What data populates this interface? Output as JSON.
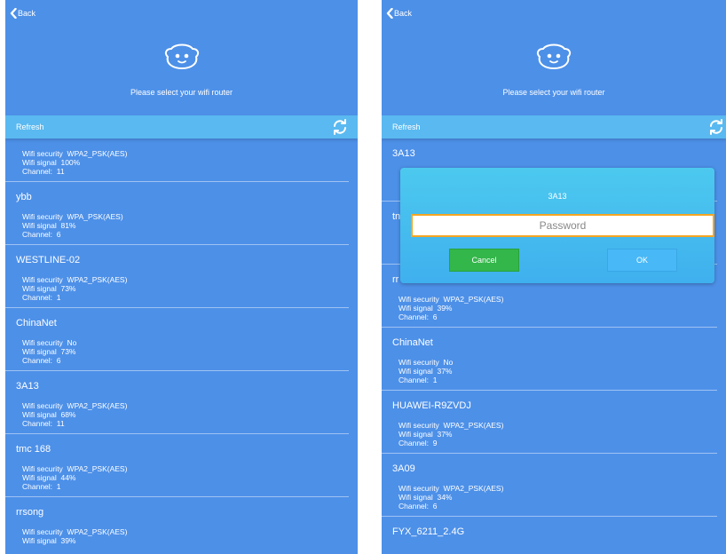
{
  "left": {
    "back_label": "Back",
    "subtitle": "Please select your wifi router",
    "refresh_label": "Refresh",
    "items": [
      {
        "name": "",
        "security_label": "Wifi security",
        "security": "WPA2_PSK(AES)",
        "signal_label": "Wifi signal",
        "signal": "100%",
        "channel_label": "Channel:",
        "channel": "11"
      },
      {
        "name": "ybb",
        "security_label": "Wifi security",
        "security": "WPA_PSK(AES)",
        "signal_label": "Wifi signal",
        "signal": "81%",
        "channel_label": "Channel:",
        "channel": "6"
      },
      {
        "name": "WESTLINE-02",
        "security_label": "Wifi security",
        "security": "WPA2_PSK(AES)",
        "signal_label": "Wifi signal",
        "signal": "73%",
        "channel_label": "Channel:",
        "channel": "1"
      },
      {
        "name": "ChinaNet",
        "security_label": "Wifi security",
        "security": "No",
        "signal_label": "Wifi signal",
        "signal": "73%",
        "channel_label": "Channel:",
        "channel": "6"
      },
      {
        "name": "3A13",
        "security_label": "Wifi security",
        "security": "WPA2_PSK(AES)",
        "signal_label": "Wifi signal",
        "signal": "68%",
        "channel_label": "Channel:",
        "channel": "11"
      },
      {
        "name": "tmc 168",
        "security_label": "Wifi security",
        "security": "WPA2_PSK(AES)",
        "signal_label": "Wifi signal",
        "signal": "44%",
        "channel_label": "Channel:",
        "channel": "1"
      },
      {
        "name": "rrsong",
        "security_label": "Wifi security",
        "security": "WPA2_PSK(AES)",
        "signal_label": "Wifi signal",
        "signal": "39%",
        "channel_label": "",
        "channel": ""
      }
    ]
  },
  "right": {
    "back_label": "Back",
    "subtitle": "Please select your wifi router",
    "refresh_label": "Refresh",
    "items": [
      {
        "name": "3A13",
        "security_label": "",
        "security": "",
        "signal_label": "",
        "signal": "",
        "channel_label": "",
        "channel": ""
      },
      {
        "name": "tn",
        "security_label": "",
        "security": "",
        "signal_label": "",
        "signal": "",
        "channel_label": "",
        "channel": ""
      },
      {
        "name": "rr",
        "security_label": "Wifi security",
        "security": "WPA2_PSK(AES)",
        "signal_label": "Wifi signal",
        "signal": "39%",
        "channel_label": "Channel:",
        "channel": "6"
      },
      {
        "name": "ChinaNet",
        "security_label": "Wifi security",
        "security": "No",
        "signal_label": "Wifi signal",
        "signal": "37%",
        "channel_label": "Channel:",
        "channel": "1"
      },
      {
        "name": "HUAWEI-R9ZVDJ",
        "security_label": "Wifi security",
        "security": "WPA2_PSK(AES)",
        "signal_label": "Wifi signal",
        "signal": "37%",
        "channel_label": "Channel:",
        "channel": "9"
      },
      {
        "name": "3A09",
        "security_label": "Wifi security",
        "security": "WPA2_PSK(AES)",
        "signal_label": "Wifi signal",
        "signal": "34%",
        "channel_label": "Channel:",
        "channel": "6"
      },
      {
        "name": "FYX_6211_2.4G",
        "security_label": "",
        "security": "",
        "signal_label": "",
        "signal": "",
        "channel_label": "",
        "channel": ""
      }
    ],
    "dialog": {
      "title": "3A13",
      "password_placeholder": "Password",
      "cancel_label": "Cancel",
      "ok_label": "OK"
    }
  },
  "colors": {
    "background": "#4d90e8",
    "refresh_bar": "#5ab9f0",
    "dialog": "#45bdef",
    "input_border": "#f5a623",
    "cancel_button": "#33b64a",
    "ok_button": "#48b8f6"
  },
  "icons": {
    "back": "chevron-left-icon",
    "face": "smiley-face-icon",
    "refresh": "refresh-icon"
  }
}
